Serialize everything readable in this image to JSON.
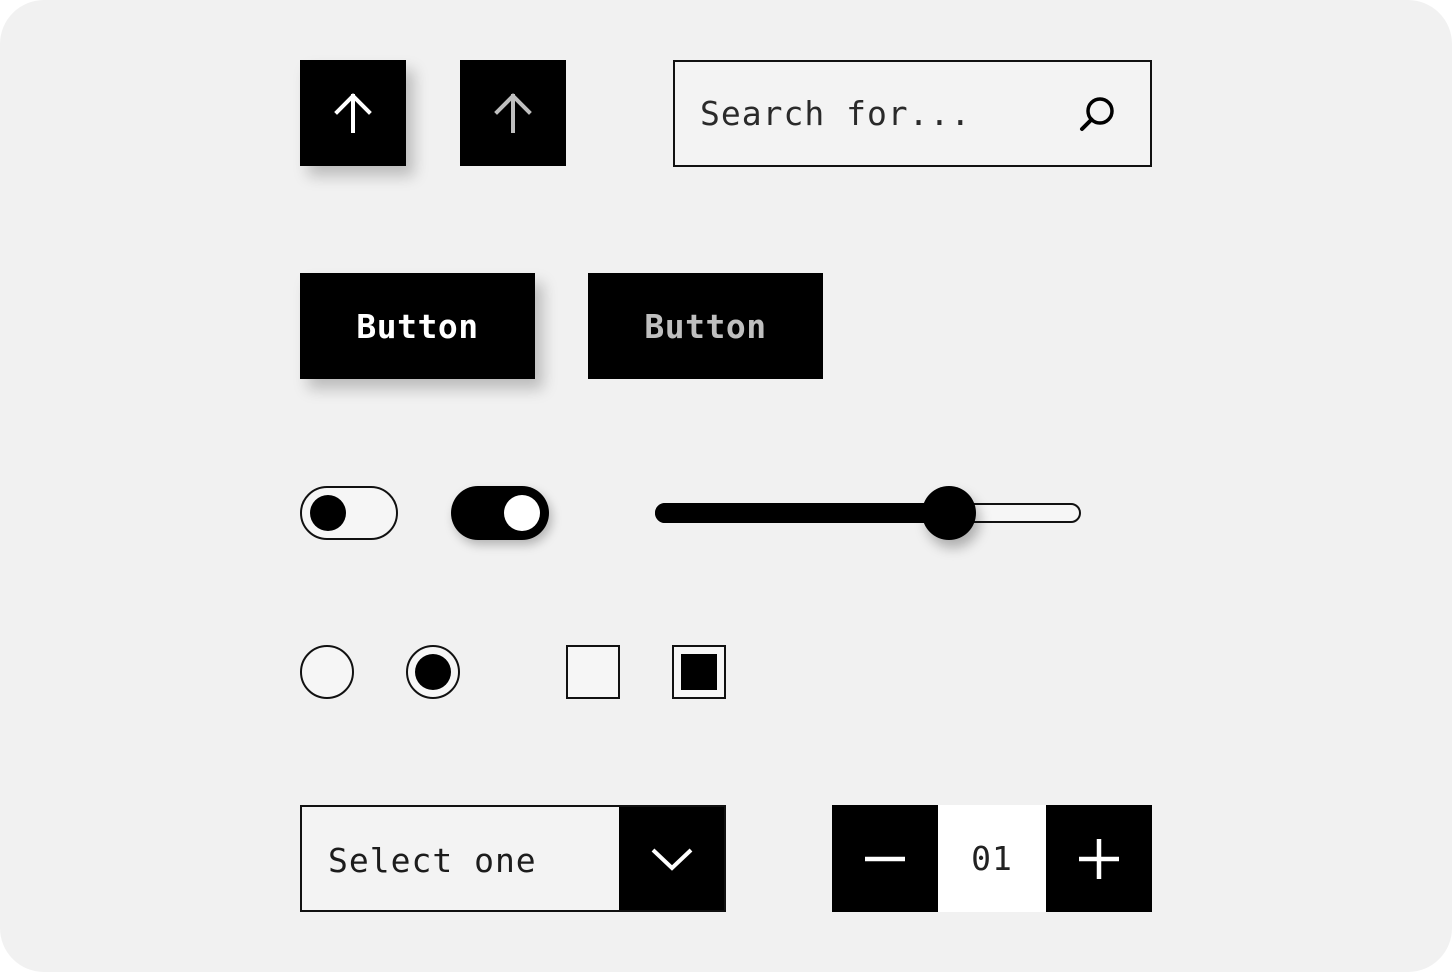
{
  "theme": {
    "background": "#f1f1f1",
    "primary": "#000000",
    "on_primary": "#ffffff",
    "on_primary_muted": "#bfbfbf"
  },
  "icon_buttons": [
    {
      "icon": "arrow-up-icon",
      "state": "raised",
      "icon_color": "#ffffff"
    },
    {
      "icon": "arrow-up-icon",
      "state": "flat",
      "icon_color": "#bfbfbf"
    }
  ],
  "search": {
    "placeholder": "Search for...",
    "value": "",
    "icon": "search-icon"
  },
  "buttons": [
    {
      "label": "Button",
      "state": "raised",
      "text_color": "#ffffff"
    },
    {
      "label": "Button",
      "state": "flat",
      "text_color": "#bfbfbf"
    }
  ],
  "toggles": [
    {
      "checked": false
    },
    {
      "checked": true
    }
  ],
  "slider": {
    "value": 0.69,
    "min": 0,
    "max": 1
  },
  "radios": [
    {
      "checked": false
    },
    {
      "checked": true
    }
  ],
  "checkboxes": [
    {
      "checked": false
    },
    {
      "checked": true
    }
  ],
  "select": {
    "value": "Select one",
    "icon": "chevron-down-icon"
  },
  "stepper": {
    "value": "01",
    "decrement_icon": "minus-icon",
    "increment_icon": "plus-icon"
  }
}
